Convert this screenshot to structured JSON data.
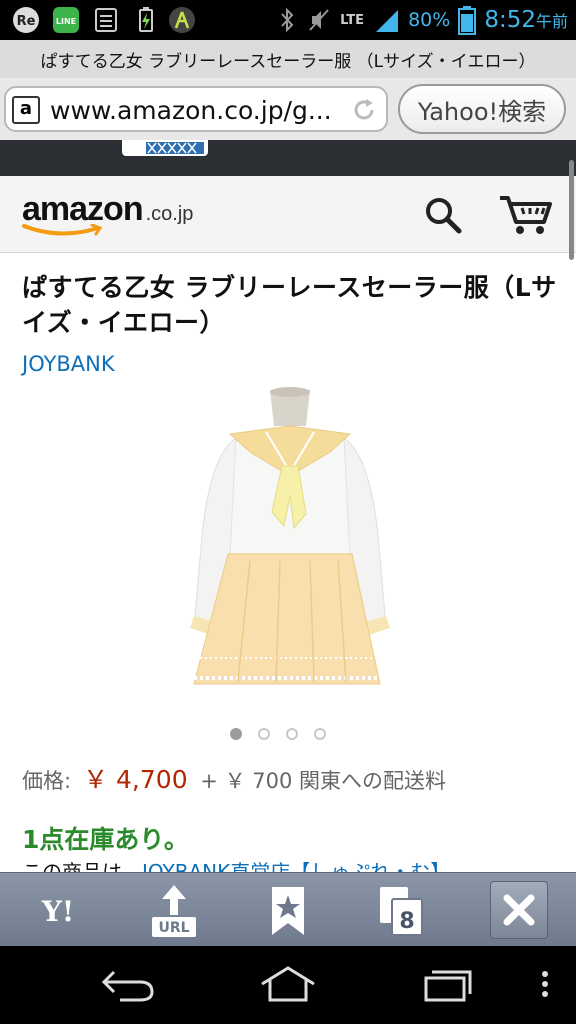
{
  "status_bar": {
    "battery_percent": "80%",
    "time": "8:52",
    "time_suffix": "午前",
    "network": "LTE",
    "icons": [
      "re-icon",
      "line-icon",
      "storage-icon",
      "battery-charging-icon",
      "antenna-icon",
      "bluetooth-icon",
      "mute-icon",
      "signal-icon",
      "battery-icon"
    ]
  },
  "browser": {
    "tab_title": "ぱすてる乙女 ラブリーレースセーラー服 （Lサイズ・イエロー）",
    "url": "www.amazon.co.jp/g...",
    "search_button": "Yahoo!検索"
  },
  "amazon": {
    "logo_word": "amazon",
    "logo_tld": ".co.jp"
  },
  "product": {
    "title": "ぱすてる乙女 ラブリーレースセーラー服（Lサイズ・イエロー）",
    "brand": "JOYBANK",
    "image_count": 4,
    "active_image": 1,
    "price_label": "価格:",
    "price": "￥ 4,700",
    "shipping": "+ ￥ 700 関東への配送料",
    "stock": "1点在庫あり。",
    "seller_prefix": "この商品は、",
    "seller_link": "JOYBANK直営店【しゅぷれ・む】"
  },
  "toolbar": {
    "tabs_count": "8",
    "url_label": "URL",
    "yahoo_label": "Y!"
  },
  "colors": {
    "brand_link": "#0d6fb8",
    "price": "#b12704",
    "stock": "#2b8a2b",
    "status_accent": "#42b6ea"
  }
}
